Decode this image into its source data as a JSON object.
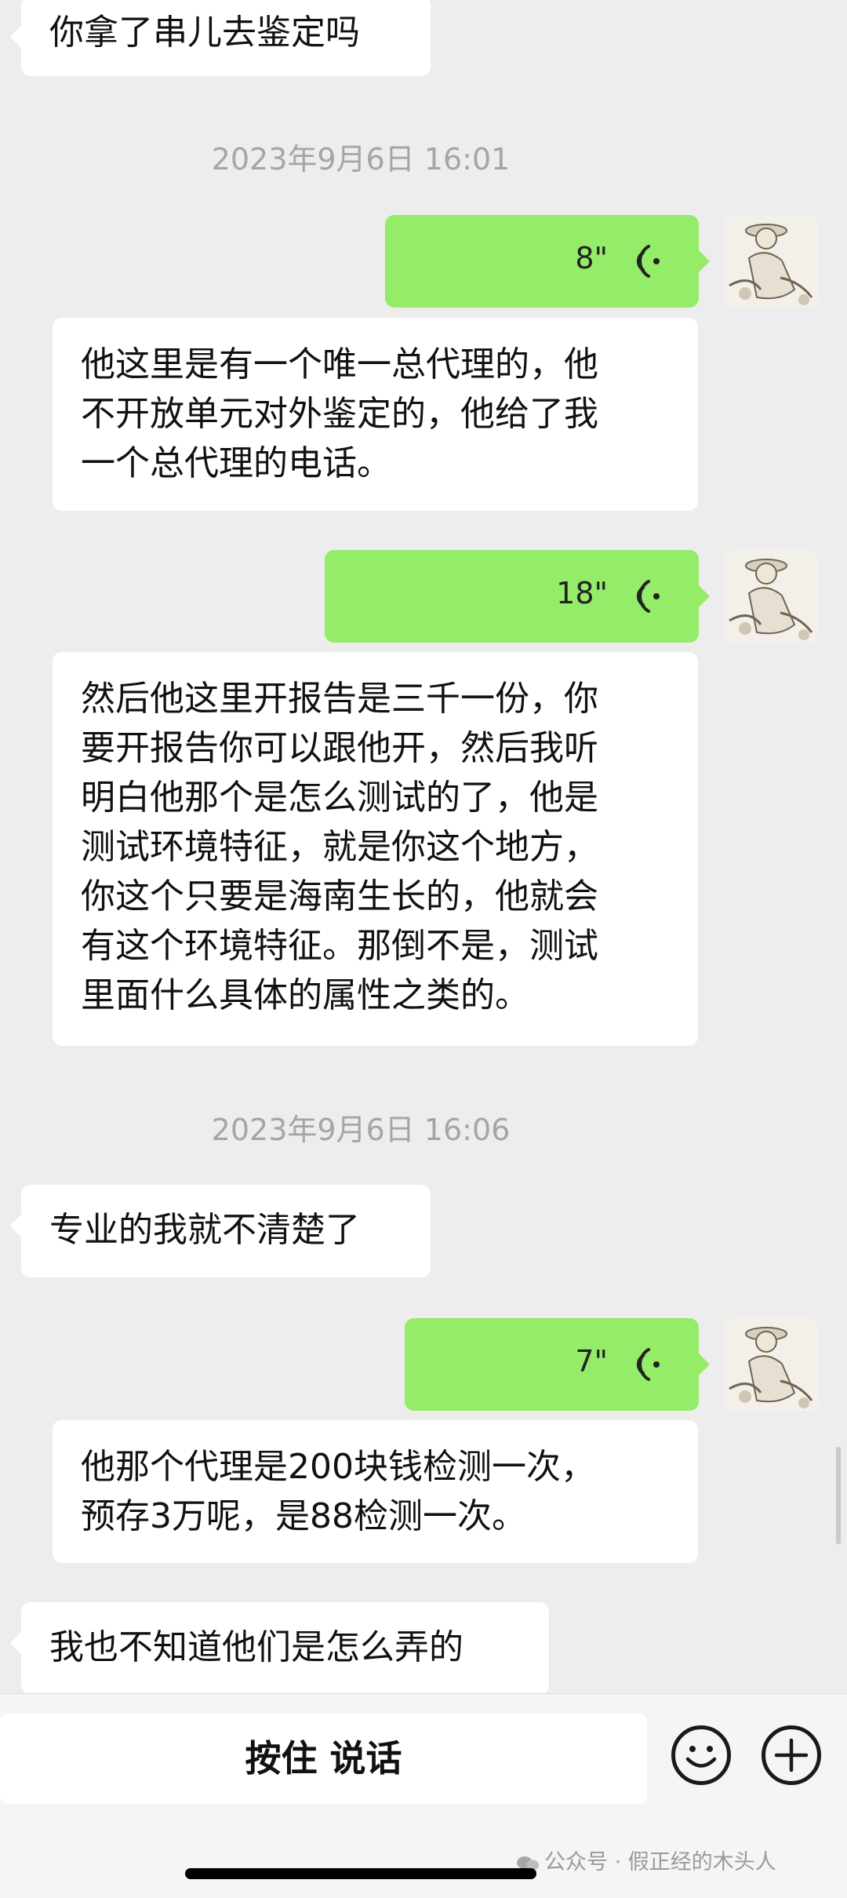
{
  "messages": {
    "m1": "你拿了串儿去鉴定吗",
    "time1": "2023年9月6日 16:01",
    "v1_duration": "8\"",
    "t1": "他这里是有一个唯一总代理的，他\n不开放单元对外鉴定的，他给了我\n一个总代理的电话。",
    "v2_duration": "18\"",
    "t2": "然后他这里开报告是三千一份，你\n要开报告你可以跟他开，然后我听\n明白他那个是怎么测试的了，他是\n测试环境特征，就是你这个地方，\n你这个只要是海南生长的，他就会\n有这个环境特征。那倒不是，测试\n里面什么具体的属性之类的。",
    "time2": "2023年9月6日 16:06",
    "m2": "专业的我就不清楚了",
    "v3_duration": "7\"",
    "t3": "他那个代理是200块钱检测一次，\n预存3万呢，是88检测一次。",
    "m3": "我也不知道他们是怎么弄的"
  },
  "input_bar": {
    "hold_to_talk": "按住 说话",
    "emoji_icon": "smiley-face",
    "plus_icon": "plus"
  },
  "watermark": "公众号 · 假正经的木头人",
  "colors": {
    "background": "#ededed",
    "voice_bubble": "#95ec69",
    "bubble": "#ffffff"
  }
}
